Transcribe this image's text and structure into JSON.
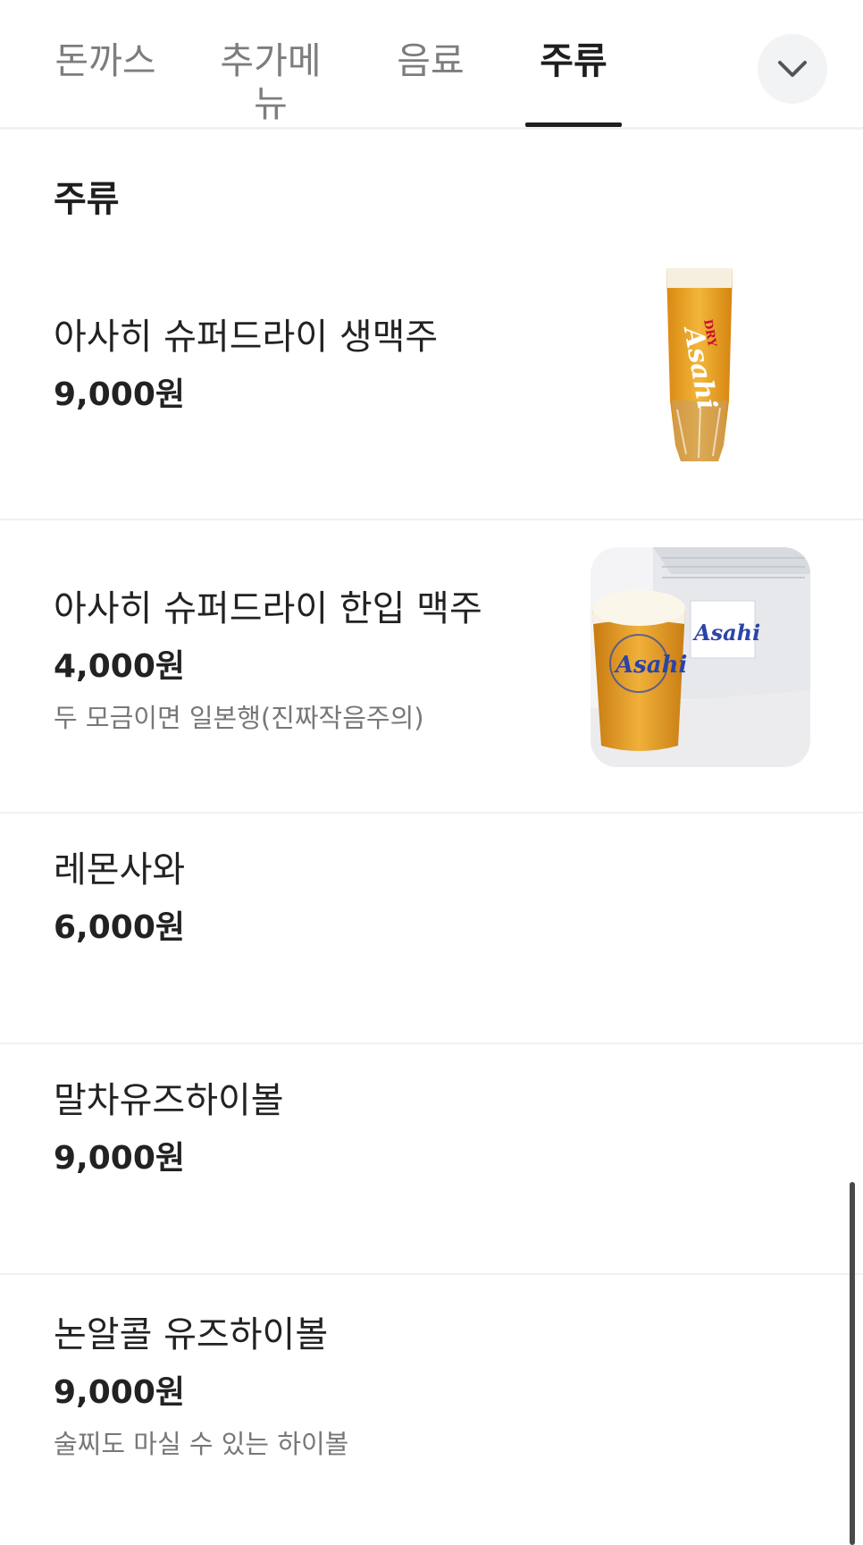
{
  "tabs": [
    {
      "label": "돈까스",
      "active": false
    },
    {
      "label": "추가메뉴",
      "active": false
    },
    {
      "label": "음료",
      "active": false
    },
    {
      "label": "주류",
      "active": true
    }
  ],
  "dropdown_icon": "chevron-down-icon",
  "section": {
    "title": "주류"
  },
  "items": [
    {
      "name": "아사히 슈퍼드라이 생맥주",
      "price": "9,000원",
      "description": "",
      "image": "asahi-draft-glass"
    },
    {
      "name": "아사히 슈퍼드라이 한입 맥주",
      "price": "4,000원",
      "description": "두 모금이면 일본행(진짜작음주의)",
      "image": "asahi-small-glass"
    },
    {
      "name": "레몬사와",
      "price": "6,000원",
      "description": ""
    },
    {
      "name": "말차유즈하이볼",
      "price": "9,000원",
      "description": ""
    },
    {
      "name": "논알콜 유즈하이볼",
      "price": "9,000원",
      "description": "술찌도 마실 수 있는 하이볼"
    }
  ],
  "brand_marks": {
    "glass1_text": "Asahi",
    "glass1_small": "DRY",
    "glass2_text": "Asahi",
    "box_text": "Asahi"
  },
  "colors": {
    "active_tab": "#1e1e1e",
    "inactive_tab": "#7d7d7d",
    "beer": "#e8a52a"
  }
}
